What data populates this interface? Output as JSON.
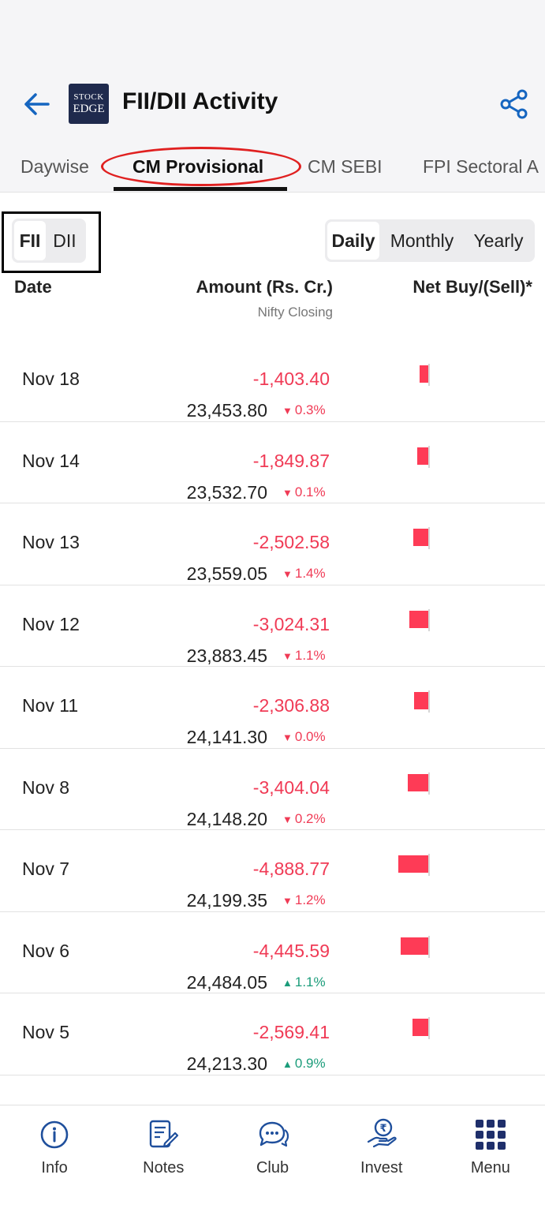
{
  "header": {
    "title": "FII/DII Activity",
    "logo_line1": "STOCK",
    "logo_line2": "EDGE"
  },
  "tabs": [
    {
      "label": "Daywise"
    },
    {
      "label": "CM Provisional",
      "active": true
    },
    {
      "label": "CM SEBI"
    },
    {
      "label": "FPI Sectoral A"
    }
  ],
  "investor_toggle": {
    "options": [
      "FII",
      "DII"
    ],
    "selected": "FII"
  },
  "period_toggle": {
    "options": [
      "Daily",
      "Monthly",
      "Yearly"
    ],
    "selected": "Daily"
  },
  "columns": {
    "date": "Date",
    "amount": "Amount (Rs. Cr.)",
    "amount_sub": "Nifty Closing",
    "net": "Net Buy/(Sell)*"
  },
  "rows": [
    {
      "date": "Nov 18",
      "amount": "-1,403.40",
      "close": "23,453.80",
      "change": "0.3%",
      "direction": "down",
      "value": -1403.4
    },
    {
      "date": "Nov 14",
      "amount": "-1,849.87",
      "close": "23,532.70",
      "change": "0.1%",
      "direction": "down",
      "value": -1849.87
    },
    {
      "date": "Nov 13",
      "amount": "-2,502.58",
      "close": "23,559.05",
      "change": "1.4%",
      "direction": "down",
      "value": -2502.58
    },
    {
      "date": "Nov 12",
      "amount": "-3,024.31",
      "close": "23,883.45",
      "change": "1.1%",
      "direction": "down",
      "value": -3024.31
    },
    {
      "date": "Nov 11",
      "amount": "-2,306.88",
      "close": "24,141.30",
      "change": "0.0%",
      "direction": "down",
      "value": -2306.88
    },
    {
      "date": "Nov 8",
      "amount": "-3,404.04",
      "close": "24,148.20",
      "change": "0.2%",
      "direction": "down",
      "value": -3404.04
    },
    {
      "date": "Nov 7",
      "amount": "-4,888.77",
      "close": "24,199.35",
      "change": "1.2%",
      "direction": "down",
      "value": -4888.77
    },
    {
      "date": "Nov 6",
      "amount": "-4,445.59",
      "close": "24,484.05",
      "change": "1.1%",
      "direction": "up",
      "value": -4445.59
    },
    {
      "date": "Nov 5",
      "amount": "-2,569.41",
      "close": "24,213.30",
      "change": "0.9%",
      "direction": "up",
      "value": -2569.41
    }
  ],
  "bottom_nav": [
    {
      "label": "Info",
      "icon": "info-icon"
    },
    {
      "label": "Notes",
      "icon": "notes-icon"
    },
    {
      "label": "Club",
      "icon": "chat-icon"
    },
    {
      "label": "Invest",
      "icon": "invest-icon"
    },
    {
      "label": "Menu",
      "icon": "grid-menu-icon"
    }
  ],
  "colors": {
    "accent": "#1565c0",
    "negative": "#f03a55",
    "positive": "#1a9c7a",
    "bar": "#fe3b56"
  }
}
